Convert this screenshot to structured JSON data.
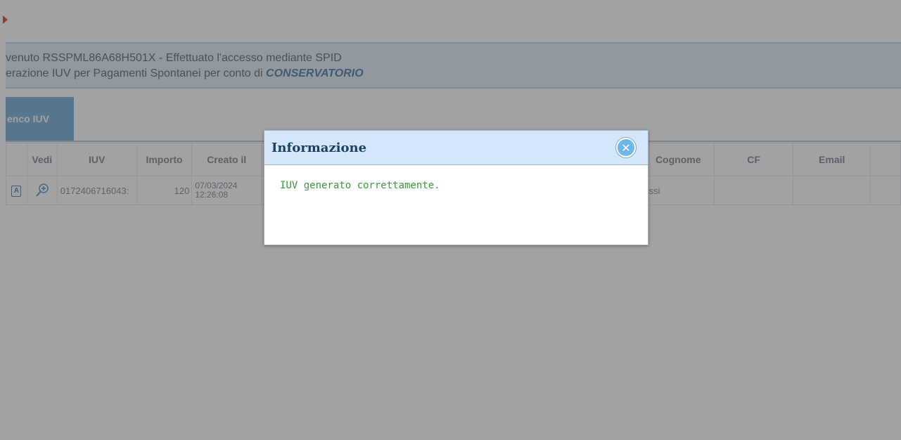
{
  "banner": {
    "line1": "venuto RSSPML86A68H501X - Effettuato l'accesso mediante SPID",
    "line2_prefix": "erazione IUV per Pagamenti Spontanei per conto di ",
    "line2_entity": "CONSERVATORIO"
  },
  "tabs": [
    {
      "label": "enco IUV",
      "active": true
    }
  ],
  "table": {
    "columns": [
      "",
      "Vedi",
      "IUV",
      "Importo",
      "Creato il",
      "",
      "Cognome",
      "CF",
      "Email",
      ""
    ],
    "rows": [
      {
        "badge": "A",
        "iuv": "0172406716043:",
        "importo": "120",
        "creato_date": "07/03/2024",
        "creato_time": "12:26:08",
        "cognome": "ossi",
        "cf": "",
        "email": ""
      }
    ]
  },
  "dialog": {
    "title": "Informazione",
    "message": "IUV generato correttamente.",
    "close_icon": "close-icon"
  },
  "colors": {
    "overlay": "#464646",
    "dialog_header": "#d3e6fa",
    "message_green": "#3a9a3a",
    "tab_active": "#6aa6d6"
  }
}
